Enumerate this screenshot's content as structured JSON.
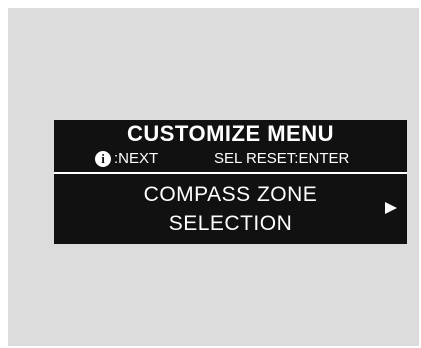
{
  "display": {
    "title": "CUSTOMIZE MENU",
    "hint": {
      "info_symbol": "i",
      "next_label": ":NEXT",
      "reset_label": "SEL RESET:ENTER"
    },
    "menu_item": {
      "line1": "COMPASS ZONE",
      "line2": "SELECTION",
      "arrow_icon": "right-triangle-icon"
    }
  }
}
